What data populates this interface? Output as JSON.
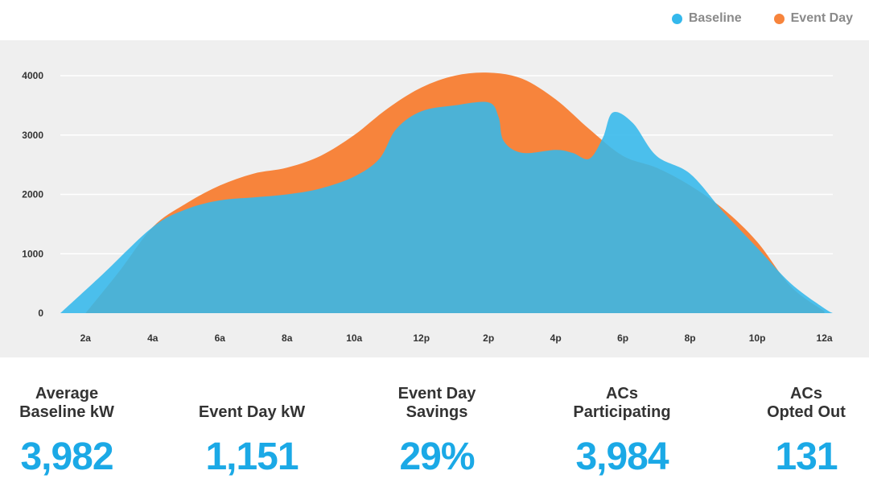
{
  "legend": [
    {
      "name": "Baseline",
      "color": "#34b8ec"
    },
    {
      "name": "Event Day",
      "color": "#f7843c"
    }
  ],
  "chart_data": {
    "type": "area",
    "x_tick_labels": [
      "2a",
      "4a",
      "6a",
      "8a",
      "10a",
      "12p",
      "2p",
      "4p",
      "6p",
      "8p",
      "10p",
      "12a"
    ],
    "y_ticks": [
      0,
      1000,
      2000,
      3000,
      4000
    ],
    "ylim": [
      0,
      4000
    ],
    "xlim": [
      1.25,
      24.25
    ],
    "grid": true,
    "legend_position": "top-right",
    "series": [
      {
        "name": "Event Day",
        "color": "#f7843c",
        "points": [
          [
            2,
            0
          ],
          [
            3,
            700
          ],
          [
            4,
            1450
          ],
          [
            5,
            1850
          ],
          [
            6,
            2150
          ],
          [
            7,
            2350
          ],
          [
            8,
            2450
          ],
          [
            9,
            2650
          ],
          [
            10,
            3000
          ],
          [
            11,
            3450
          ],
          [
            12,
            3800
          ],
          [
            13,
            4000
          ],
          [
            14,
            4050
          ],
          [
            15,
            3950
          ],
          [
            16,
            3600
          ],
          [
            17,
            3100
          ],
          [
            18,
            2650
          ],
          [
            19,
            2450
          ],
          [
            20,
            2150
          ],
          [
            21,
            1750
          ],
          [
            22,
            1200
          ],
          [
            23,
            450
          ],
          [
            24,
            30
          ]
        ]
      },
      {
        "name": "Baseline",
        "color": "#34b8ec",
        "points": [
          [
            1.25,
            0
          ],
          [
            2.5,
            650
          ],
          [
            4,
            1450
          ],
          [
            5,
            1750
          ],
          [
            6,
            1900
          ],
          [
            7,
            1950
          ],
          [
            8,
            2000
          ],
          [
            9,
            2100
          ],
          [
            10,
            2300
          ],
          [
            10.75,
            2600
          ],
          [
            11.25,
            3100
          ],
          [
            12,
            3400
          ],
          [
            13,
            3500
          ],
          [
            14,
            3550
          ],
          [
            14.3,
            3300
          ],
          [
            14.45,
            2900
          ],
          [
            15,
            2700
          ],
          [
            16,
            2750
          ],
          [
            16.5,
            2700
          ],
          [
            17,
            2600
          ],
          [
            17.4,
            2950
          ],
          [
            17.7,
            3380
          ],
          [
            18.3,
            3200
          ],
          [
            19,
            2650
          ],
          [
            20,
            2350
          ],
          [
            21,
            1700
          ],
          [
            22,
            1100
          ],
          [
            23,
            500
          ],
          [
            24,
            80
          ],
          [
            24.25,
            0
          ]
        ]
      }
    ]
  },
  "stats": [
    {
      "label": "Average\nBaseline kW",
      "value": "3,982"
    },
    {
      "label": "Event Day kW",
      "value": "1,151"
    },
    {
      "label": "Event Day\nSavings",
      "value": "29%"
    },
    {
      "label": "ACs\nParticipating",
      "value": "3,984"
    },
    {
      "label": "ACs\nOpted Out",
      "value": "131"
    }
  ]
}
